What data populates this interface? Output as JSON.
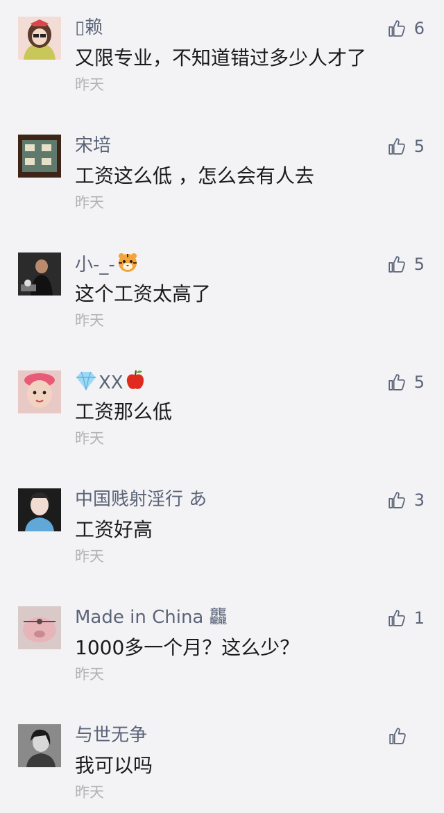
{
  "comments": [
    {
      "name": "▯赖",
      "text": "又限专业，不知道错过多少人才了",
      "time": "昨天",
      "likes": "6"
    },
    {
      "name": "宋培",
      "text": "工资这么低 ，怎么会有人去",
      "time": "昨天",
      "likes": "5"
    },
    {
      "name": "小-_-",
      "text": "这个工资太高了",
      "time": "昨天",
      "likes": "5"
    },
    {
      "name": "XX",
      "text": "工资那么低",
      "time": "昨天",
      "likes": "5"
    },
    {
      "name": "中国贱射淫行 あ",
      "text": "工资好高",
      "time": "昨天",
      "likes": "3"
    },
    {
      "name": "Made in China 龘",
      "text": "1000多一个月？这么少？",
      "time": "昨天",
      "likes": "1"
    },
    {
      "name": "与世无争",
      "text": "我可以吗",
      "time": "昨天",
      "likes": ""
    }
  ]
}
